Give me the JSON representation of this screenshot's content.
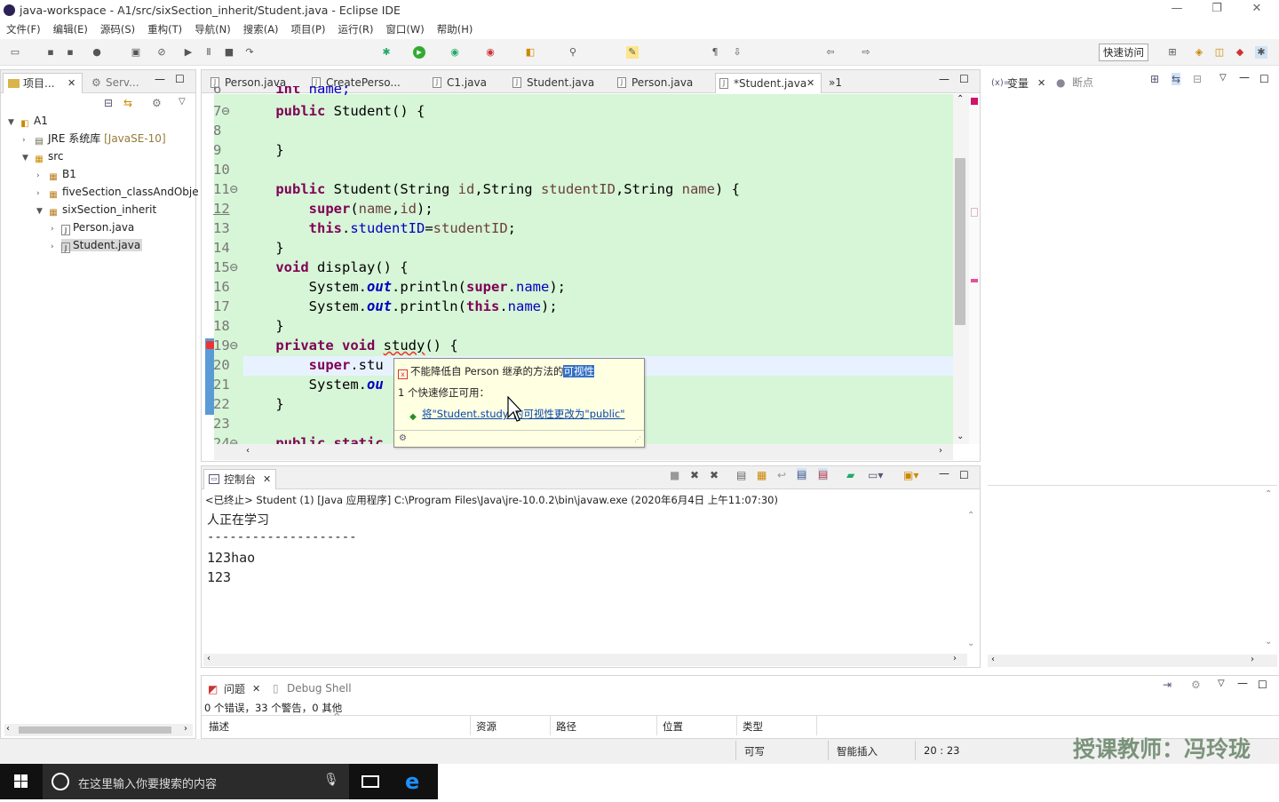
{
  "window": {
    "title": "java-workspace - A1/src/sixSection_inherit/Student.java - Eclipse IDE"
  },
  "menu": [
    "文件(F)",
    "编辑(E)",
    "源码(S)",
    "重构(T)",
    "导航(N)",
    "搜索(A)",
    "项目(P)",
    "运行(R)",
    "窗口(W)",
    "帮助(H)"
  ],
  "toolbar": {
    "quick_access": "快速访问"
  },
  "project_explorer": {
    "tabs": [
      "项目...",
      "Serv..."
    ],
    "tree": [
      {
        "label": "A1"
      },
      {
        "label": "JRE 系统库",
        "suffix": "[JavaSE-10]"
      },
      {
        "label": "src"
      },
      {
        "label": "B1"
      },
      {
        "label": "fiveSection_classAndObje"
      },
      {
        "label": "sixSection_inherit"
      },
      {
        "label": "Person.java"
      },
      {
        "label": "Student.java"
      }
    ]
  },
  "editor": {
    "tabs": [
      "Person.java",
      "CreatePerso...",
      "C1.java",
      "Student.java",
      "Person.java",
      "*Student.java",
      "»1"
    ],
    "lines": [
      {
        "n": "6",
        "code": "    int name;"
      },
      {
        "n": "7⊖",
        "code": "    public Student() {"
      },
      {
        "n": "8",
        "code": ""
      },
      {
        "n": "9",
        "code": "    }"
      },
      {
        "n": "10",
        "code": ""
      },
      {
        "n": "11⊖",
        "code": "    public Student(String id,String studentID,String name) {"
      },
      {
        "n": "12",
        "code": "        super(name,id);"
      },
      {
        "n": "13",
        "code": "        this.studentID=studentID;"
      },
      {
        "n": "14",
        "code": "    }"
      },
      {
        "n": "15⊖",
        "code": "    void display() {"
      },
      {
        "n": "16",
        "code": "        System.out.println(super.name);"
      },
      {
        "n": "17",
        "code": "        System.out.println(this.name);"
      },
      {
        "n": "18",
        "code": "    }"
      },
      {
        "n": "19⊖",
        "code": "    private void study() {"
      },
      {
        "n": "20",
        "code": "        super.stu"
      },
      {
        "n": "21",
        "code": "        System.ou"
      },
      {
        "n": "22",
        "code": "    }"
      },
      {
        "n": "23",
        "code": ""
      },
      {
        "n": "24⊖",
        "code": "    public static"
      }
    ]
  },
  "hover": {
    "message_prefix": "不能降低自 Person 继承的方法的",
    "message_highlight": "可视性",
    "fix_count": "1 个快速修正可用：",
    "fix": "将\"Student.study\"的可视性更改为\"public\""
  },
  "variables_panel": {
    "tabs": [
      "变量",
      "断点"
    ]
  },
  "console": {
    "tab": "控制台",
    "header": "<已终止> Student (1) [Java 应用程序] C:\\Program Files\\Java\\jre-10.0.2\\bin\\javaw.exe (2020年6月4日 上午11:07:30)",
    "lines": [
      "人正在学习",
      "--------------------",
      "123hao",
      "123"
    ]
  },
  "problems": {
    "tabs": [
      "问题",
      "Debug Shell"
    ],
    "summary": "0 个错误，33 个警告，0 其他",
    "columns": [
      "描述",
      "资源",
      "路径",
      "位置",
      "类型"
    ]
  },
  "status": {
    "writable": "可写",
    "insert": "智能插入",
    "position": "20 : 23"
  },
  "watermark": "授课教师：冯玲珑",
  "taskbar": {
    "search_placeholder": "在这里输入你要搜索的内容"
  }
}
